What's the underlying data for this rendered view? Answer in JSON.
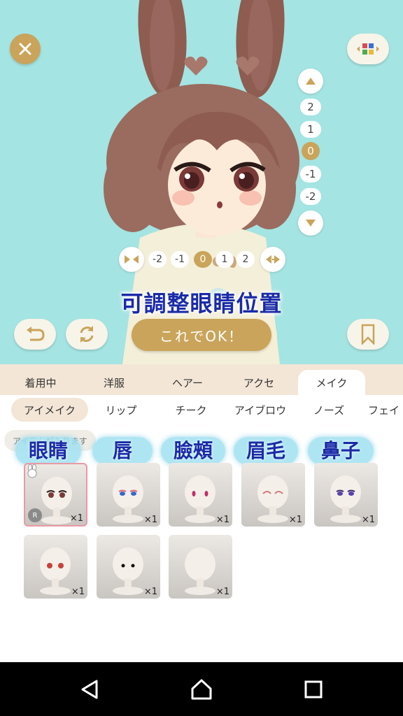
{
  "top": {
    "close_icon": "close-icon",
    "palette_icon": "color-palette-icon",
    "undo_icon": "undo-icon",
    "rotate_icon": "rotate-icon",
    "bookmark_icon": "bookmark-icon",
    "ok_button": "これでOK！",
    "adjust_note": "可調整眼睛位置"
  },
  "vertical_scale": {
    "ticks": [
      "2",
      "1",
      "0",
      "-1",
      "-2"
    ],
    "selected": "0"
  },
  "horizontal_scale": {
    "ticks": [
      "-2",
      "-1",
      "0",
      "1",
      "2"
    ],
    "selected": "0"
  },
  "tabs_main": [
    "着用中",
    "洋服",
    "ヘアー",
    "アクセ",
    "メイク"
  ],
  "tabs_main_active": "メイク",
  "tabs_sub": [
    "アイメイク",
    "リップ",
    "チーク",
    "アイブロウ",
    "ノーズ",
    "フェイ"
  ],
  "tabs_sub_active": "アイメイク",
  "content": {
    "hint": "アイテムが入ります",
    "category_labels": [
      "眼睛",
      "唇",
      "臉頰",
      "眉毛",
      "鼻子"
    ],
    "items": [
      {
        "count": "×1",
        "badge": "R",
        "selected": true
      },
      {
        "count": "×1"
      },
      {
        "count": "×1"
      },
      {
        "count": "×1"
      },
      {
        "count": "×1"
      },
      {
        "count": "×1"
      },
      {
        "count": "×1"
      },
      {
        "count": "×1"
      }
    ]
  },
  "colors": {
    "preview_bg": "#a4e4e2",
    "accent_gold": "#c9a45a",
    "tab_bg": "#f3e6d6",
    "label_blue": "#1a2ba8"
  },
  "navbar": {
    "back_icon": "back-triangle-icon",
    "home_icon": "home-icon",
    "recents_icon": "recents-square-icon"
  }
}
